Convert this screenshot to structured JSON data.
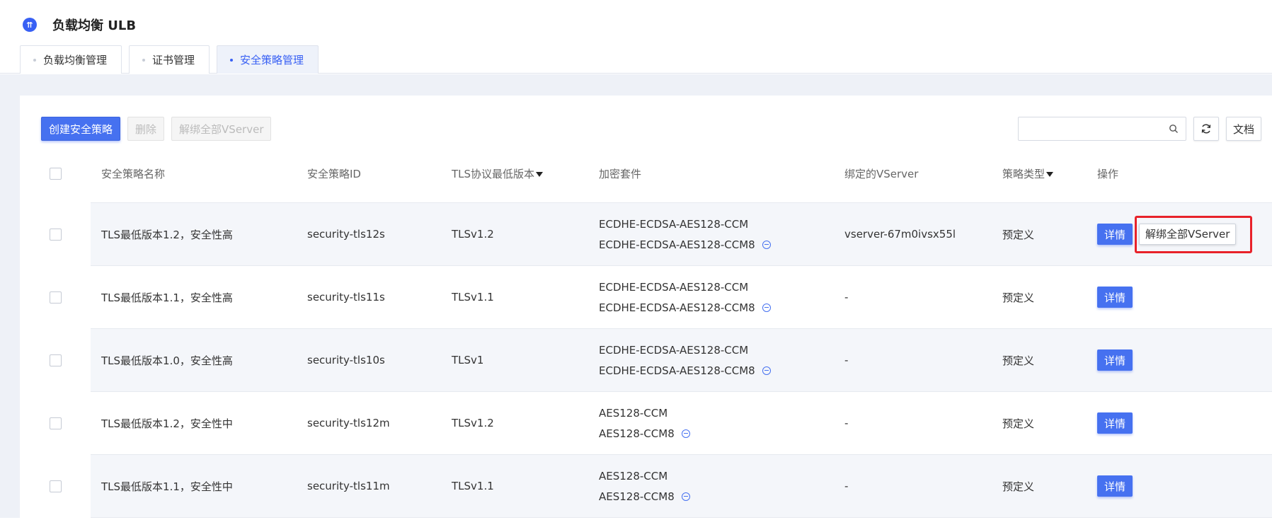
{
  "app": {
    "logo_glyph": "⇈",
    "title": "负载均衡 ULB"
  },
  "tabs": [
    {
      "label": "负载均衡管理",
      "active": false
    },
    {
      "label": "证书管理",
      "active": false
    },
    {
      "label": "安全策略管理",
      "active": true
    }
  ],
  "toolbar": {
    "create_label": "创建安全策略",
    "delete_label": "删除",
    "unbind_all_label": "解绑全部VServer",
    "search_placeholder": "",
    "doc_label": "文档"
  },
  "table": {
    "headers": {
      "name": "安全策略名称",
      "id": "安全策略ID",
      "tls": "TLS协议最低版本",
      "cipher": "加密套件",
      "vserver": "绑定的VServer",
      "type": "策略类型",
      "ops": "操作"
    },
    "detail_label": "详情",
    "unbind_label": "解绑全部VServer",
    "rows": [
      {
        "name": "TLS最低版本1.2，安全性高",
        "id": "security-tls12s",
        "tls": "TLSv1.2",
        "cipher1": "ECDHE-ECDSA-AES128-CCM",
        "cipher2": "ECDHE-ECDSA-AES128-CCM8",
        "vserver": "vserver-67m0ivsx55l",
        "type": "预定义"
      },
      {
        "name": "TLS最低版本1.1，安全性高",
        "id": "security-tls11s",
        "tls": "TLSv1.1",
        "cipher1": "ECDHE-ECDSA-AES128-CCM",
        "cipher2": "ECDHE-ECDSA-AES128-CCM8",
        "vserver": "-",
        "type": "预定义"
      },
      {
        "name": "TLS最低版本1.0，安全性高",
        "id": "security-tls10s",
        "tls": "TLSv1",
        "cipher1": "ECDHE-ECDSA-AES128-CCM",
        "cipher2": "ECDHE-ECDSA-AES128-CCM8",
        "vserver": "-",
        "type": "预定义"
      },
      {
        "name": "TLS最低版本1.2，安全性中",
        "id": "security-tls12m",
        "tls": "TLSv1.2",
        "cipher1": "AES128-CCM",
        "cipher2": "AES128-CCM8",
        "vserver": "-",
        "type": "预定义"
      },
      {
        "name": "TLS最低版本1.1，安全性中",
        "id": "security-tls11m",
        "tls": "TLSv1.1",
        "cipher1": "AES128-CCM",
        "cipher2": "AES128-CCM8",
        "vserver": "-",
        "type": "预定义"
      }
    ]
  },
  "colors": {
    "primary": "#4671f0",
    "highlight_border": "#e8222a",
    "page_bg": "#eef1f7"
  }
}
